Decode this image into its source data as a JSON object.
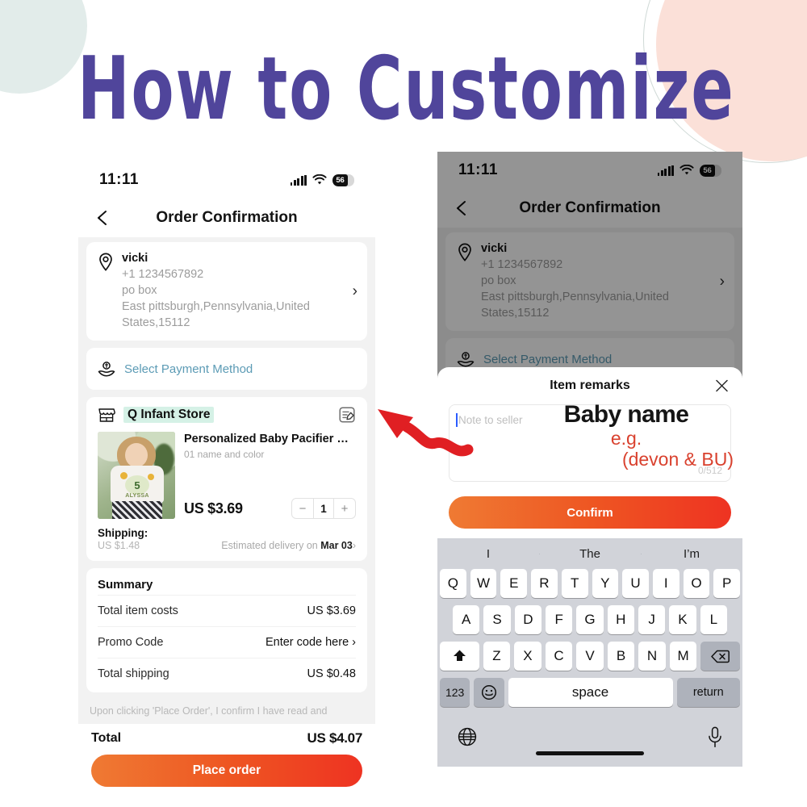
{
  "banner": {
    "title": "How to Customize",
    "title_color": "#50459b"
  },
  "decor": {
    "mint_circle": "#e2ecea",
    "pink_circle": "#fbe0d8",
    "arc_stroke": "#cfd9d6"
  },
  "left_phone": {
    "status": {
      "time": "11:11",
      "battery": "56",
      "signal_icon": "signal-bars-icon",
      "wifi_icon": "wifi-icon",
      "battery_icon": "battery-icon"
    },
    "nav": {
      "back_icon": "back-arrow-icon",
      "title": "Order Confirmation"
    },
    "address": {
      "pin_icon": "location-pin-icon",
      "name": "vicki",
      "phone": "+1 1234567892",
      "line1": "po box",
      "line2": "East pittsburgh,Pennsylvania,United",
      "line3": "States,15112",
      "chevron": "›"
    },
    "payment": {
      "icon": "payment-hand-coin-icon",
      "label": "Select Payment Method",
      "label_color": "#5c9bb5"
    },
    "store": {
      "icon": "store-icon",
      "name": "Q Infant Store",
      "highlight_color": "#d5f1e6",
      "edit_icon": "edit-note-icon"
    },
    "product": {
      "image_alt": "girl-in-white-tshirt-photo",
      "title": "Personalized Baby Pacifier Clip Custo…",
      "variant": "01 name and color",
      "price": "US $3.69",
      "qty_minus": "−",
      "qty": "1",
      "qty_plus": "+"
    },
    "shipping": {
      "label": "Shipping:",
      "cost": "US $1.48",
      "delivery_prefix": "Estimated delivery on ",
      "delivery_date": "Mar 03",
      "chevron": "›"
    },
    "summary": {
      "title": "Summary",
      "rows": [
        {
          "label": "Total item costs",
          "value": "US $3.69"
        },
        {
          "label": "Promo Code",
          "value": "Enter code here ›"
        },
        {
          "label": "Total shipping",
          "value": "US $0.48"
        }
      ]
    },
    "legal": "Upon clicking 'Place Order', I confirm I have read and",
    "footer": {
      "total_label": "Total",
      "total_value": "US $4.07",
      "cta": "Place order"
    }
  },
  "right_phone": {
    "status": {
      "time": "11:11",
      "battery": "56"
    },
    "nav": {
      "title": "Order Confirmation"
    },
    "address": {
      "name": "vicki",
      "phone": "+1 1234567892",
      "line1": "po box",
      "line2": "East pittsburgh,Pennsylvania,United",
      "line3": "States,15112",
      "chevron": "›"
    },
    "payment": {
      "label": "Select Payment Method"
    },
    "modal": {
      "title": "Item remarks",
      "close_icon": "close-icon",
      "note_placeholder": "Note to seller",
      "char_count": "0/512",
      "cta": "Confirm",
      "annotation": {
        "heading": "Baby name",
        "eg": "e.g.",
        "example": "(devon & BU)",
        "heading_color": "#151515",
        "accent_color": "#d9412e"
      }
    },
    "keyboard": {
      "predictions": [
        "I",
        "The",
        "I’m"
      ],
      "row1": [
        "Q",
        "W",
        "E",
        "R",
        "T",
        "Y",
        "U",
        "I",
        "O",
        "P"
      ],
      "row2": [
        "A",
        "S",
        "D",
        "F",
        "G",
        "H",
        "J",
        "K",
        "L"
      ],
      "row3": [
        "Z",
        "X",
        "C",
        "V",
        "B",
        "N",
        "M"
      ],
      "shift_icon": "shift-up-icon",
      "backspace_icon": "backspace-icon",
      "numbers_key": "123",
      "emoji_icon": "emoji-smiley-icon",
      "space_key": "space",
      "return_key": "return",
      "globe_icon": "globe-icon",
      "mic_icon": "microphone-icon"
    }
  },
  "annotation_arrow": {
    "name": "red-curved-arrow",
    "color": "#e01f23"
  }
}
